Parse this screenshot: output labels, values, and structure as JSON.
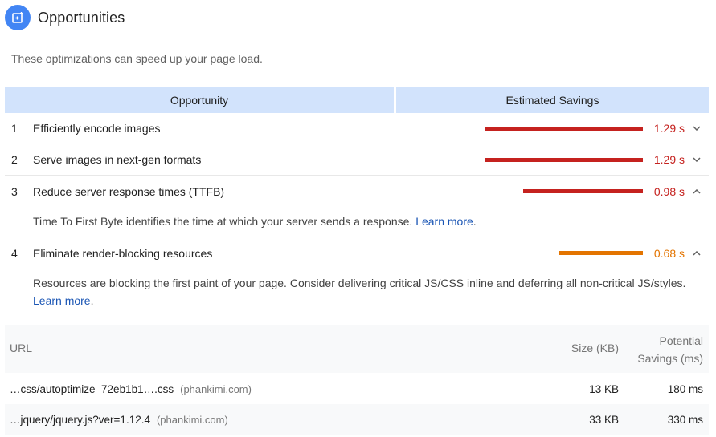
{
  "section": {
    "title": "Opportunities",
    "icon": "opportunity-icon",
    "description": "These optimizations can speed up your page load."
  },
  "table": {
    "headers": {
      "opportunity": "Opportunity",
      "savings": "Estimated Savings"
    },
    "rows": [
      {
        "index": "1",
        "title": "Efficiently encode images",
        "value": "1.29 s",
        "fraction": 1.0,
        "color": "#c5221f",
        "expanded": false,
        "chevron": "chevron-down-icon"
      },
      {
        "index": "2",
        "title": "Serve images in next-gen formats",
        "value": "1.29 s",
        "fraction": 1.0,
        "color": "#c5221f",
        "expanded": false,
        "chevron": "chevron-down-icon"
      },
      {
        "index": "3",
        "title": "Reduce server response times (TTFB)",
        "value": "0.98 s",
        "fraction": 0.76,
        "color": "#c5221f",
        "expanded": true,
        "chevron": "chevron-up-icon",
        "description": "Time To First Byte identifies the time at which your server sends a response.",
        "link": "Learn more"
      },
      {
        "index": "4",
        "title": "Eliminate render-blocking resources",
        "value": "0.68 s",
        "fraction": 0.53,
        "color": "#e37400",
        "expanded": true,
        "chevron": "chevron-up-icon",
        "description": "Resources are blocking the first paint of your page. Consider delivering critical JS/CSS inline and deferring all non-critical JS/styles.",
        "link": "Learn more"
      }
    ]
  },
  "resources": {
    "headers": {
      "url": "URL",
      "size": "Size (KB)",
      "savings_line1": "Potential",
      "savings_line2": "Savings (ms)"
    },
    "rows": [
      {
        "url": "…css/autoptimize_72eb1b1….css",
        "host": "(phankimi.com)",
        "size": "13 KB",
        "savings": "180 ms"
      },
      {
        "url": "…jquery/jquery.js?ver=1.12.4",
        "host": "(phankimi.com)",
        "size": "33 KB",
        "savings": "330 ms"
      }
    ]
  }
}
